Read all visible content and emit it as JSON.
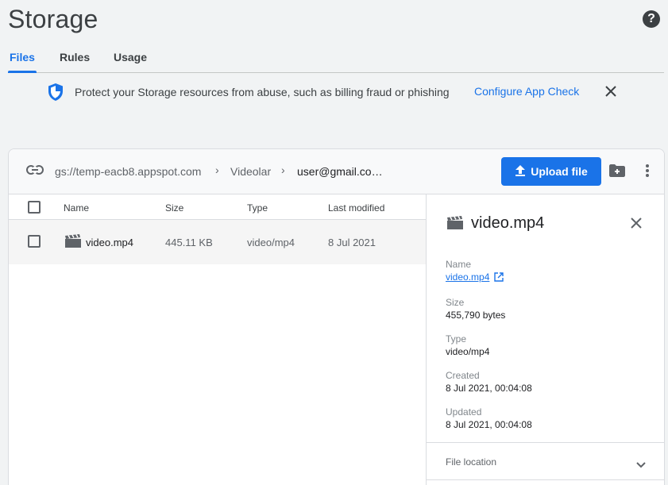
{
  "page": {
    "title": "Storage"
  },
  "tabs": [
    {
      "label": "Files",
      "active": true
    },
    {
      "label": "Rules",
      "active": false
    },
    {
      "label": "Usage",
      "active": false
    }
  ],
  "banner": {
    "text": "Protect your Storage resources from abuse, such as billing fraud or phishing",
    "link_label": "Configure App Check"
  },
  "breadcrumbs": [
    "gs://temp-eacb8.appspot.com",
    "Videolar",
    "user@gmail.co…"
  ],
  "toolbar": {
    "upload_label": "Upload file"
  },
  "table": {
    "columns": [
      "Name",
      "Size",
      "Type",
      "Last modified"
    ],
    "rows": [
      {
        "name": "video.mp4",
        "size": "445.11 KB",
        "type": "video/mp4",
        "modified": "8 Jul 2021"
      }
    ]
  },
  "detail": {
    "title": "video.mp4",
    "fields": {
      "name_label": "Name",
      "name_value": "video.mp4",
      "size_label": "Size",
      "size_value": "455,790 bytes",
      "type_label": "Type",
      "type_value": "video/mp4",
      "created_label": "Created",
      "created_value": "8 Jul 2021, 00:04:08",
      "updated_label": "Updated",
      "updated_value": "8 Jul 2021, 00:04:08"
    },
    "file_location_label": "File location"
  },
  "colors": {
    "accent": "#1a73e8",
    "background": "#f1f3f4",
    "text": "#202124"
  },
  "icons": [
    "help-icon",
    "shield-icon",
    "close-icon",
    "link-icon",
    "chevron-right-icon",
    "upload-icon",
    "folder-add-icon",
    "more-vert-icon",
    "video-file-icon",
    "open-external-icon",
    "chevron-down-icon"
  ]
}
